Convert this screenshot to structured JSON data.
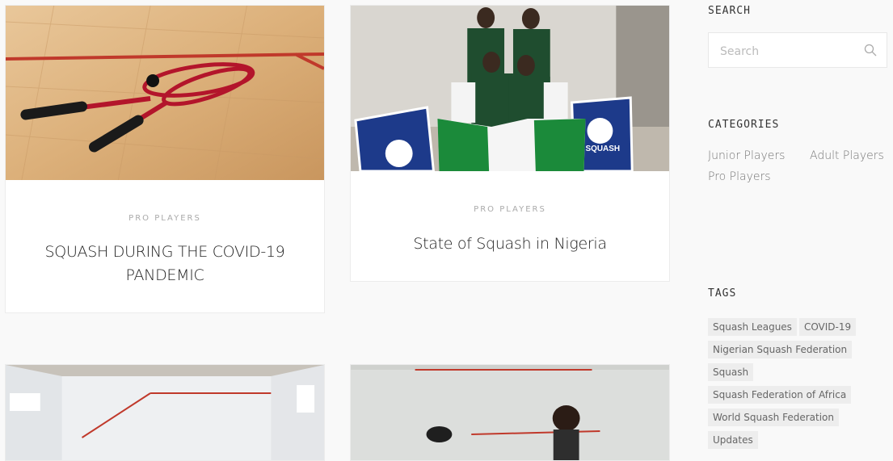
{
  "posts": [
    {
      "category": "PRO PLAYERS",
      "title": "SQUASH DURING THE COVID-19 PANDEMIC"
    },
    {
      "category": "PRO PLAYERS",
      "title": "State of Squash in Nigeria"
    }
  ],
  "sidebar": {
    "search": {
      "heading": "SEARCH",
      "placeholder": "Search"
    },
    "categories": {
      "heading": "CATEGORIES",
      "items": [
        "Junior Players",
        "Adult Players",
        "Pro Players"
      ]
    },
    "tags": {
      "heading": "TAGS",
      "items": [
        "Squash Leagues",
        "COVID-19",
        "Nigerian Squash Federation",
        "Squash",
        "Squash Federation of Africa",
        "World Squash Federation",
        "Updates"
      ]
    }
  },
  "images": {
    "post1": "squash-rackets-on-court-image",
    "post2": "nigeria-team-with-flag-image",
    "post3": "white-squash-court-image",
    "post4": "players-in-court-image"
  }
}
